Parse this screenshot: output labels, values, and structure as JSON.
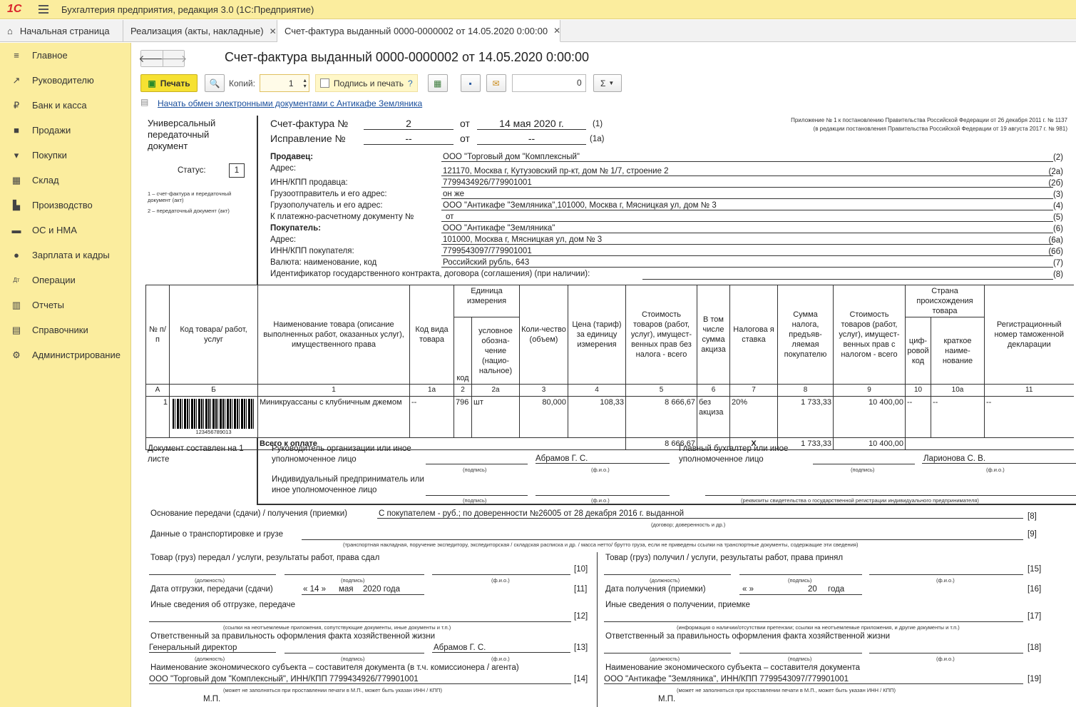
{
  "app": {
    "title": "Бухгалтерия предприятия, редакция 3.0  (1С:Предприятие)",
    "logo": "1С"
  },
  "tabs": [
    {
      "label": "Начальная страница"
    },
    {
      "label": "Реализация (акты, накладные)"
    },
    {
      "label": "Счет-фактура выданный 0000-0000002 от 14.05.2020 0:00:00"
    }
  ],
  "sidebar": {
    "items": [
      {
        "label": "Главное",
        "icon": "menu-list-icon"
      },
      {
        "label": "Руководителю",
        "icon": "trend-icon"
      },
      {
        "label": "Банк и касса",
        "icon": "coin-icon"
      },
      {
        "label": "Продажи",
        "icon": "bag-icon"
      },
      {
        "label": "Покупки",
        "icon": "cart-icon"
      },
      {
        "label": "Склад",
        "icon": "grid-icon"
      },
      {
        "label": "Производство",
        "icon": "factory-icon"
      },
      {
        "label": "ОС и НМА",
        "icon": "truck-icon"
      },
      {
        "label": "Зарплата и кадры",
        "icon": "person-icon"
      },
      {
        "label": "Операции",
        "icon": "dt-kt-icon"
      },
      {
        "label": "Отчеты",
        "icon": "bar-chart-icon"
      },
      {
        "label": "Справочники",
        "icon": "book-icon"
      },
      {
        "label": "Администрирование",
        "icon": "gear-icon"
      }
    ]
  },
  "doc": {
    "title": "Счет-фактура выданный 0000-0000002 от 14.05.2020 0:00:00"
  },
  "toolbar": {
    "print": "Печать",
    "copies_label": "Копий:",
    "copies": "1",
    "sign_print": "Подпись и печать",
    "help": "?",
    "number": "0",
    "sum": "Σ"
  },
  "edo_link": "Начать обмен электронными документами с Антикафе Земляника",
  "form": {
    "upd": "Универсальный передаточный документ",
    "status_label": "Статус:",
    "status": "1",
    "status_note1": "1 – счет-фактура и передаточный документ (акт)",
    "status_note2": "2 – передаточный документ (акт)",
    "appendix1": "Приложение № 1 к постановлению Правительства Российской Федерации от 26 декабря 2011 г. № 1137",
    "appendix2": "(в редакции постановления Правительства Российской Федерации от 19 августа 2017 г. № 981)",
    "sf_label": "Счет-фактура №",
    "sf_num": "2",
    "ot": "от",
    "sf_date": "14 мая 2020 г.",
    "c1": "(1)",
    "corr_label": "Исправление №",
    "corr_num": "--",
    "corr_date": "--",
    "c1a": "(1а)",
    "rows": [
      {
        "label": "Продавец:",
        "value": "ООО \"Торговый дом \"Комплексный\"",
        "code": "(2)",
        "bold": true
      },
      {
        "label": "Адрес:",
        "value": "121170, Москва г, Кутузовский пр-кт, дом № 1/7, строение 2",
        "code": "(2а)"
      },
      {
        "label": "ИНН/КПП продавца:",
        "value": "7799434926/779901001",
        "code": "(2б)"
      },
      {
        "label": "Грузоотправитель и его адрес:",
        "value": "он же",
        "code": "(3)"
      },
      {
        "label": "Грузополучатель и его адрес:",
        "value": "ООО \"Антикафе \"Земляника\",101000, Москва г, Мясницкая ул, дом № 3",
        "code": "(4)"
      },
      {
        "label": "К платежно-расчетному документу №",
        "value": "  от",
        "code": "(5)"
      },
      {
        "label": "Покупатель:",
        "value": "ООО \"Антикафе \"Земляника\"",
        "code": "(6)",
        "bold": true
      },
      {
        "label": "Адрес:",
        "value": "101000, Москва г, Мясницкая ул, дом № 3",
        "code": "(6а)"
      },
      {
        "label": "ИНН/КПП покупателя:",
        "value": "7799543097/779901001",
        "code": "(6б)"
      },
      {
        "label": "Валюта: наименование, код",
        "value": "Российский рубль, 643",
        "code": "(7)"
      }
    ],
    "ident_label": "Идентификатор государственного контракта, договора (соглашения) (при наличии):",
    "c8": "(8)",
    "table": {
      "h": {
        "n": "№ п/п",
        "code": "Код товара/ работ, услуг",
        "name": "Наименование товара (описание выполненных работ, оказанных услуг), имущественного права",
        "kind": "Код вида товара",
        "unit": "Единица измерения",
        "unit_code": "код",
        "unit_name": "условное обозна-чение (нацио-нальное)",
        "qty": "Коли-чество (объем)",
        "price": "Цена (тариф) за единицу измерения",
        "cost": "Стоимость товаров (работ, услуг), имущест-венных прав без налога - всего",
        "excise": "В том числе сумма акциза",
        "rate": "Налогова я ставка",
        "tax": "Сумма налога, предъяв-ляемая покупателю",
        "total": "Стоимость товаров (работ, услуг), имущест-венных прав с налогом - всего",
        "country": "Страна происхождения товара",
        "country_code": "циф-ровой код",
        "country_name": "краткое наиме-нование",
        "customs": "Регистрационный номер таможенной декларации"
      },
      "nums": [
        "А",
        "Б",
        "1",
        "1а",
        "2",
        "2а",
        "3",
        "4",
        "5",
        "6",
        "7",
        "8",
        "9",
        "10",
        "10а",
        "11"
      ],
      "row": {
        "n": "1",
        "barcode": "123456789013",
        "name": "Миникруассаны с клубничным джемом",
        "kind": "--",
        "unit_code": "796",
        "unit_name": "шт",
        "qty": "80,000",
        "price": "108,33",
        "cost": "8 666,67",
        "excise": "без акциза",
        "rate": "20%",
        "tax": "1 733,33",
        "total": "10 400,00",
        "country_code": "--",
        "country_name": "--",
        "customs": "--"
      },
      "total": {
        "label": "Всего к оплате",
        "cost": "8 666,67",
        "x": "Х",
        "tax": "1 733,33",
        "total": "10 400,00"
      }
    },
    "sheets": "Документ составлен на 1 листе",
    "head_label": "Руководитель организации или иное уполномоченное лицо",
    "head_name": "Абрамов Г. С.",
    "acc_label": "Главный бухгалтер или иное уполномоченное лицо",
    "acc_name": "Ларионова С. В.",
    "ip_label": "Индивидуальный предприниматель или иное уполномоченное лицо",
    "podpis": "(подпись)",
    "fio": "(ф.и.о.)",
    "dolzh": "(должность)",
    "ip_req": "(реквизиты свидетельства о государственной  регистрации индивидуального предпринимателя)",
    "basis_label": "Основание передачи (сдачи) / получения (приемки)",
    "basis_value": "С покупателем - руб.; по доверенности №26005 от 28 декабря 2016 г. выданной",
    "basis_hint": "(договор; доверенность и др.)",
    "c8b": "[8]",
    "transport_label": "Данные о транспортировке и грузе",
    "transport_hint": "(транспортная накладная, поручение экспедитору, экспедиторская / складская расписка и др. / масса нетто/ брутто груза, если не приведены ссылки на транспортные документы, содержащие эти сведения)",
    "c9": "[9]",
    "left": {
      "handed": "Товар (груз) передал / услуги, результаты работ, права сдал",
      "c10": "[10]",
      "ship_date_label": "Дата отгрузки, передачи (сдачи)",
      "ship_day": "« 14 »",
      "ship_month": "мая",
      "ship_year": "2020  года",
      "c11": "[11]",
      "other": "Иные сведения об отгрузке, передаче",
      "c12": "[12]",
      "other_hint": "(ссылки на неотъемлемые приложения, сопутствующие документы, иные документы и т.п.)",
      "resp": "Ответственный за правильность оформления факта хозяйственной жизни",
      "resp_pos": "Генеральный директор",
      "resp_name": "Абрамов Г. С.",
      "c13": "[13]",
      "entity": "Наименование экономического субъекта – составителя документа (в т.ч. комиссионера / агента)",
      "entity_value": "ООО \"Торговый дом \"Комплексный\", ИНН/КПП 7799434926/779901001",
      "c14": "[14]",
      "entity_hint": "(может не заполняться при проставлении печати в М.П., может быть указан ИНН / КПП)",
      "mp": "М.П."
    },
    "right": {
      "received": "Товар (груз) получил / услуги, результаты работ, права принял",
      "c15": "[15]",
      "rec_date_label": "Дата получения (приемки)",
      "rec_day": "«      »",
      "rec_year": "20",
      "rec_word": "года",
      "c16": "[16]",
      "other": "Иные сведения о получении, приемке",
      "c17": "[17]",
      "other_hint": "(информация о наличии/отсутствии претензии; ссылки на неотъемлемые приложения, и другие  документы и т.п.)",
      "resp": "Ответственный за правильность оформления факта хозяйственной жизни",
      "c18": "[18]",
      "entity": "Наименование экономического субъекта – составителя документа",
      "entity_value": "ООО \"Антикафе \"Земляника\", ИНН/КПП 7799543097/779901001",
      "c19": "[19]",
      "entity_hint": "(может не заполняться при проставлении печати в М.П., может быть указан ИНН / КПП)",
      "mp": "М.П."
    }
  }
}
